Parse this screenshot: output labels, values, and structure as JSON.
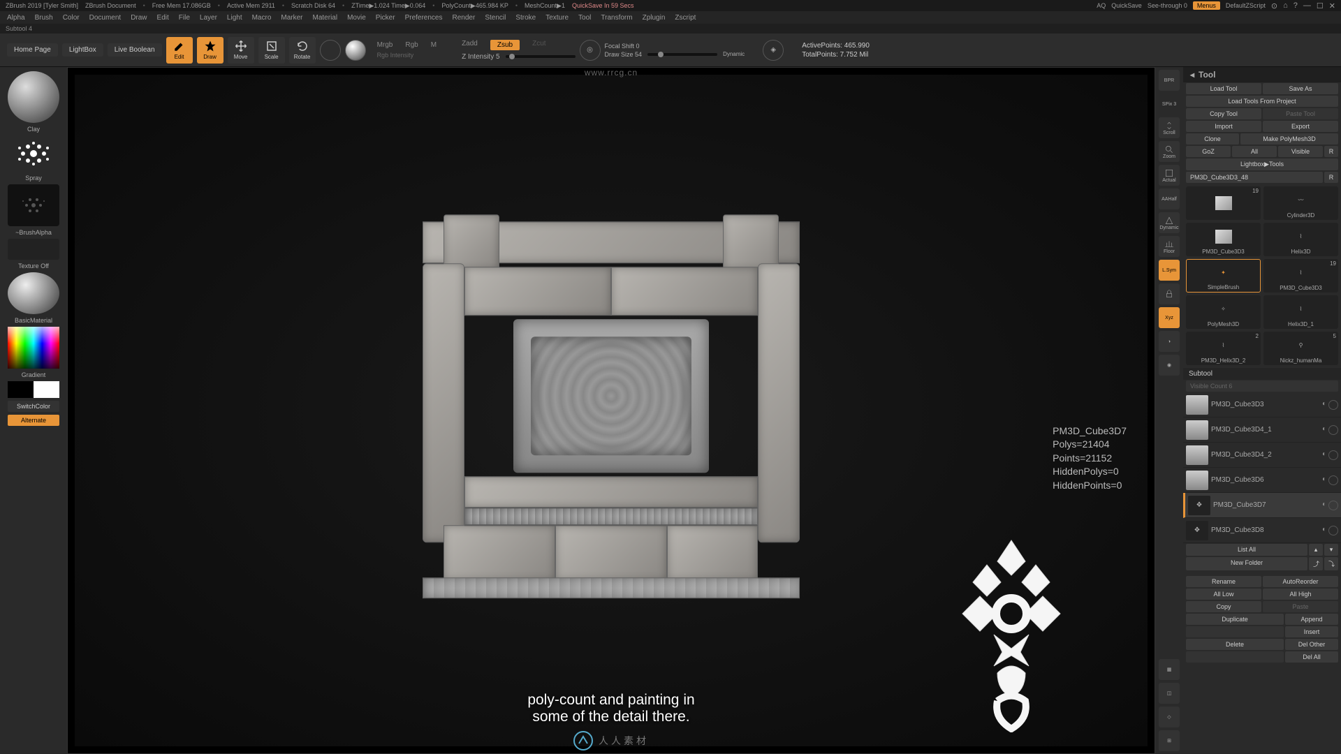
{
  "titlebar": {
    "app": "ZBrush 2019 [Tyler Smith]",
    "doc": "ZBrush Document",
    "freemem": "Free Mem 17.086GB",
    "activemem": "Active Mem 2911",
    "scratch": "Scratch Disk 64",
    "ztime": "ZTime▶1.024 Time▶0.064",
    "polycount": "PolyCount▶465.984 KP",
    "meshcount": "MeshCount▶1",
    "quicksave": "QuickSave In 59 Secs",
    "watermark": "www.rrcg.cn",
    "aq": "AQ",
    "qs": "QuickSave",
    "seethrough": "See-through  0",
    "menus": "Menus",
    "script": "DefaultZScript"
  },
  "menubar": [
    "Alpha",
    "Brush",
    "Color",
    "Document",
    "Draw",
    "Edit",
    "File",
    "Layer",
    "Light",
    "Macro",
    "Marker",
    "Material",
    "Movie",
    "Picker",
    "Preferences",
    "Render",
    "Stencil",
    "Stroke",
    "Texture",
    "Tool",
    "Transform",
    "Zplugin",
    "Zscript"
  ],
  "subhead": "Subtool 4",
  "toolbar": {
    "homepage": "Home Page",
    "lightbox": "LightBox",
    "liveboolean": "Live Boolean",
    "edit": "Edit",
    "draw": "Draw",
    "move": "Move",
    "scale": "Scale",
    "rotate": "Rotate",
    "mrgb": "Mrgb",
    "rgb": "Rgb",
    "m": "M",
    "rgbint": "Rgb Intensity",
    "zadd": "Zadd",
    "zsub": "Zsub",
    "zcut": "Zcut",
    "zint": "Z Intensity 5",
    "focal": "Focal Shift 0",
    "drawsize": "Draw Size 54",
    "dynamic": "Dynamic",
    "activepoints": "ActivePoints: 465.990",
    "totalpoints": "TotalPoints: 7.752 Mil"
  },
  "left": {
    "material": "Clay",
    "spray": "Spray",
    "brushalpha": "~BrushAlpha",
    "texture": "Texture Off",
    "basicmaterial": "BasicMaterial",
    "gradient": "Gradient",
    "switchcolor": "SwitchColor",
    "alternate": "Alternate"
  },
  "rightstrip": {
    "bpr": "BPR",
    "spix": "SPix 3",
    "scroll": "Scroll",
    "zoom": "Zoom",
    "actual": "Actual",
    "aahalf": "AAHalf",
    "persp": "Dynamic",
    "floor": "Floor",
    "localsym": "L.Sym",
    "lock": "",
    "xyz": "Xyz"
  },
  "tool": {
    "header": "Tool",
    "loadtool": "Load Tool",
    "saveas": "Save As",
    "loadproject": "Load Tools From Project",
    "copytool": "Copy Tool",
    "pastetool": "Paste Tool",
    "import": "Import",
    "export": "Export",
    "clone": "Clone",
    "makepm3d": "Make PolyMesh3D",
    "goz": "GoZ",
    "all": "All",
    "visible": "Visible",
    "r": "R",
    "lightbox": "Lightbox▶Tools",
    "activeName": "PM3D_Cube3D3_48",
    "thumbs": [
      {
        "label": "",
        "count": "19"
      },
      {
        "label": "Cylinder3D"
      },
      {
        "label": "PM3D_Cube3D3"
      },
      {
        "label": "Helix3D"
      },
      {
        "label": "SimpleBrush",
        "sel": true
      },
      {
        "label": "PM3D_Cube3D3",
        "count": "19"
      },
      {
        "label": "PolyMesh3D"
      },
      {
        "label": "Helix3D_1"
      },
      {
        "label": "PM3D_Helix3D_2",
        "count": "2"
      },
      {
        "label": "Nickz_humanMa",
        "count": "5"
      }
    ],
    "subtool": "Subtool",
    "visiblecount": "Visible Count 6",
    "subtools": [
      {
        "name": "PM3D_Cube3D3"
      },
      {
        "name": "PM3D_Cube3D4_1"
      },
      {
        "name": "PM3D_Cube3D4_2"
      },
      {
        "name": "PM3D_Cube3D6"
      },
      {
        "name": "PM3D_Cube3D7",
        "sel": true,
        "shape": true
      },
      {
        "name": "PM3D_Cube3D8",
        "shape": true
      }
    ],
    "listall": "List All",
    "newfolder": "New Folder",
    "rename": "Rename",
    "autoreorder": "AutoReorder",
    "alllow": "All Low",
    "allhigh": "All High",
    "copy": "Copy",
    "paste": "Paste",
    "duplicate": "Duplicate",
    "append": "Append",
    "insert": "Insert",
    "delete": "Delete",
    "delother": "Del Other",
    "delall": "Del All"
  },
  "meshinfo": {
    "name": "PM3D_Cube3D7",
    "polys": "Polys=21404",
    "points": "Points=21152",
    "hiddenp": "HiddenPolys=0",
    "hiddenpt": "HiddenPoints=0"
  },
  "caption_l1": "poly-count and painting in",
  "caption_l2": "some of the detail there.",
  "footer_watermark": "人人素材"
}
